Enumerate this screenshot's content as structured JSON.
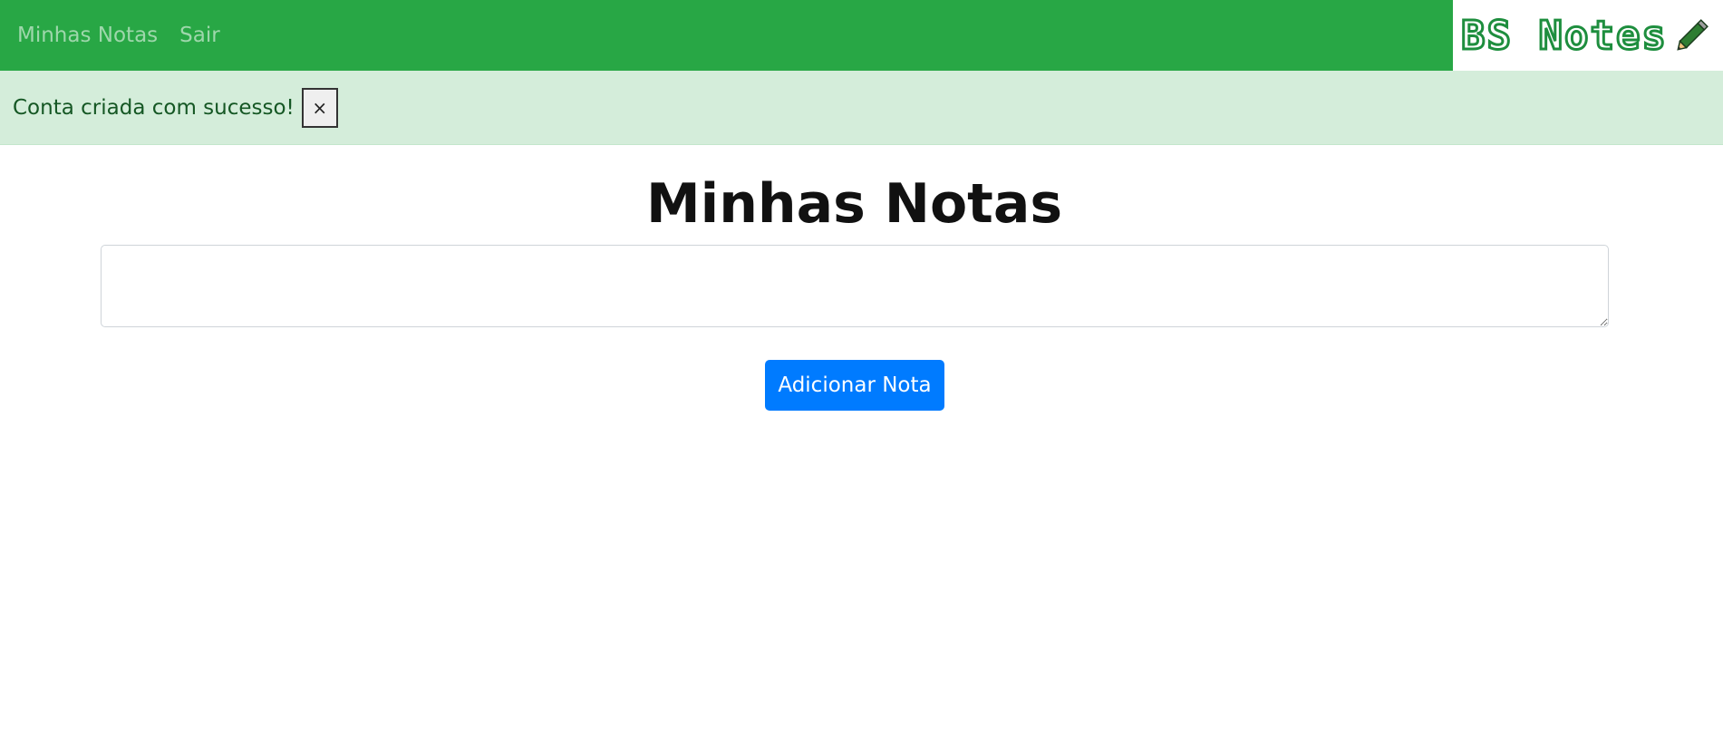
{
  "navbar": {
    "links": [
      "Minhas Notas",
      "Sair"
    ],
    "brand": "BS Notes",
    "brand_icon": "pencil-icon",
    "background": "#28a745"
  },
  "alert": {
    "message": "Conta criada com sucesso!",
    "close_label": "×",
    "background": "#d4edda"
  },
  "main": {
    "title": "Minhas Notas",
    "note_input": {
      "value": "",
      "placeholder": ""
    },
    "add_button_label": "Adicionar Nota",
    "add_button_color": "#007bff"
  }
}
